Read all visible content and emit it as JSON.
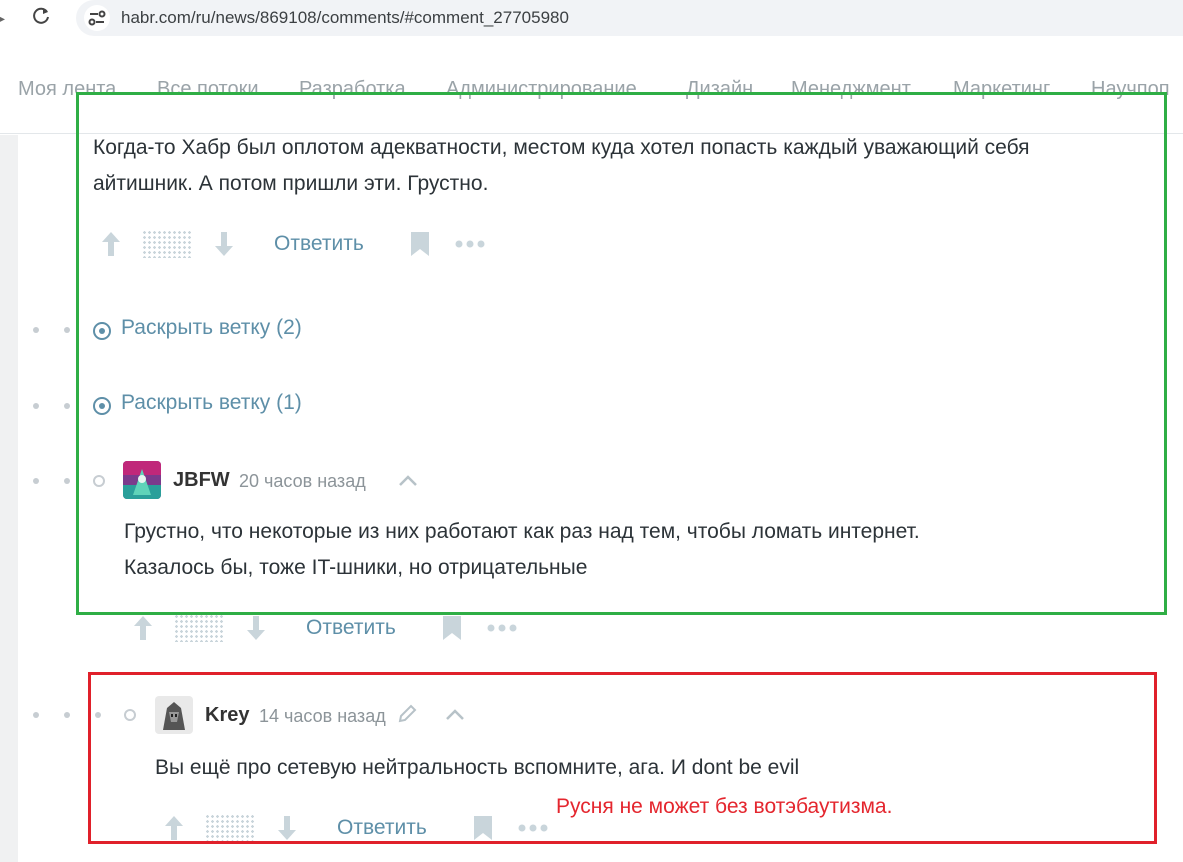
{
  "browser": {
    "url": "habr.com/ru/news/869108/comments/#comment_27705980"
  },
  "menu": {
    "items": [
      "Моя лента",
      "Все потоки",
      "Разработка",
      "Администрирование",
      "Дизайн",
      "Менеджмент",
      "Маркетинг",
      "Научпоп"
    ]
  },
  "comments": [
    {
      "text_lines": [
        "Когда-то Хабр был оплотом адекватности, местом куда хотел попасть каждый уважающий себя",
        "айтишник. А потом пришли эти. Грустно."
      ],
      "reply_label": "Ответить"
    },
    {
      "author": "JBFW",
      "time": "20 часов назад",
      "text_lines": [
        "Грустно, что некоторые из них работают как раз над тем, чтобы ломать интернет.",
        "Казалось бы, тоже IT-шники, но отрицательные"
      ],
      "reply_label": "Ответить"
    },
    {
      "author": "Krey",
      "time": "14 часов назад",
      "text_lines": [
        "Вы ещё про сетевую нейтральность вспомните, ага. И dont be evil"
      ],
      "reply_label": "Ответить"
    }
  ],
  "branches": [
    {
      "label": "Раскрыть ветку (2)"
    },
    {
      "label": "Раскрыть ветку (1)"
    }
  ],
  "annotation": {
    "text": "Русня не может без вотэбаутизма.",
    "green_color": "#2fae45",
    "red_color": "#e0202a"
  }
}
